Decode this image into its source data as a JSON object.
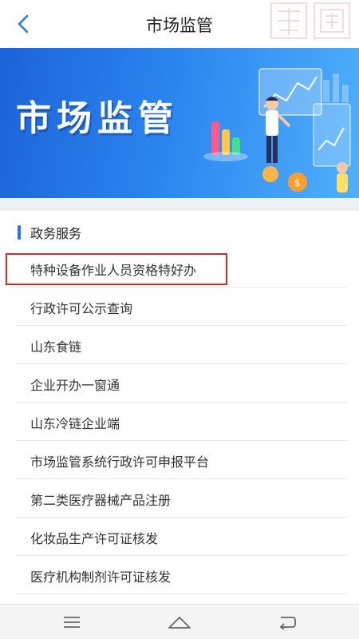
{
  "header": {
    "title": "市场监管",
    "back_icon": "chevron-left-icon",
    "seal_icon": "decorative-seal-icon"
  },
  "banner": {
    "title": "市场监管"
  },
  "section": {
    "title": "政务服务",
    "items": [
      {
        "label": "特种设备作业人员资格特好办",
        "highlighted": true
      },
      {
        "label": "行政许可公示查询"
      },
      {
        "label": "山东食链"
      },
      {
        "label": "企业开办一窗通"
      },
      {
        "label": "山东冷链企业端"
      },
      {
        "label": "市场监管系统行政许可申报平台"
      },
      {
        "label": "第二类医疗器械产品注册"
      },
      {
        "label": "化妆品生产许可证核发"
      },
      {
        "label": "医疗机构制剂许可证核发"
      }
    ]
  },
  "colors": {
    "accent": "#2a73e8",
    "highlight_border": "#c9302c",
    "banner_gradient_start": "#1c63d8",
    "banner_gradient_end": "#4fb0fb"
  },
  "bottom_nav": {
    "menu_icon": "menu-icon",
    "home_icon": "home-icon",
    "back_icon": "back-icon"
  }
}
